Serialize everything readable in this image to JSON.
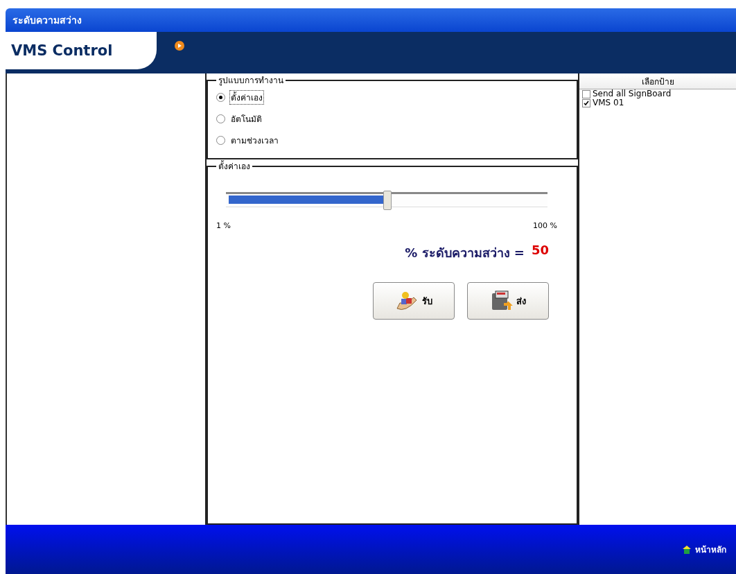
{
  "window": {
    "title": "ระดับความสว่าง"
  },
  "header": {
    "logo": "VMS Control"
  },
  "mode_group": {
    "title": "รูปแบบการทำงาน",
    "options": [
      {
        "label": "ตั้งค่าเอง",
        "selected": true
      },
      {
        "label": "อัตโนมัติ",
        "selected": false
      },
      {
        "label": "ตามช่วงเวลา",
        "selected": false
      }
    ]
  },
  "manual_group": {
    "title": "ตั้งค่าเอง",
    "slider": {
      "level": 0.5,
      "min_label": "1 %",
      "max_label": "100 %"
    },
    "reading_label": "% ระดับความสว่าง =",
    "reading_value": "50",
    "buttons": [
      {
        "kind": "receive",
        "label": "รับ"
      },
      {
        "kind": "send",
        "label": "ส่ง"
      }
    ]
  },
  "sign_list": {
    "header": "เลือกป้าย",
    "items": [
      {
        "label": "Send all SignBoard",
        "checked": false
      },
      {
        "label": "VMS 01",
        "checked": true
      }
    ]
  },
  "footer": {
    "home_link": "หน้าหลัก"
  }
}
